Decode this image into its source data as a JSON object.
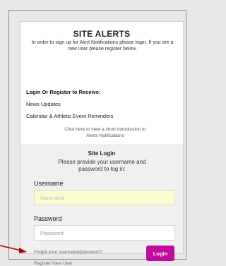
{
  "card": {
    "title": "SITE ALERTS",
    "intro": "In order to sign up for Alert Notifications please login. If you are a new user please register below.",
    "receive_heading": "Login Or Register to Receive:",
    "receive_items": [
      "News Updates",
      "Calendar & Athletic Event Reminders"
    ],
    "intro_link": "Click here to view a short introduction to Alerts Notifications"
  },
  "login": {
    "title": "Site Login",
    "subtitle": "Please provide your username and password to log in:",
    "username_label": "Username",
    "username_placeholder": "Username",
    "password_label": "Password",
    "password_placeholder": "Password",
    "forgot_link": "Forgot your username/password?",
    "register_link": "Register New User",
    "login_button": "Login"
  },
  "colors": {
    "login_button": "#c00aa0",
    "username_field_bg": "#fbfbcf",
    "arrow": "#b00000"
  }
}
